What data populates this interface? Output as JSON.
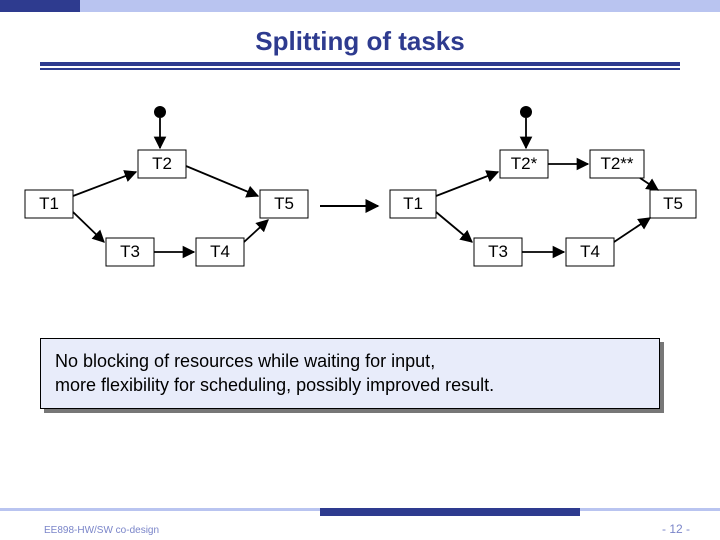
{
  "title": "Splitting of tasks",
  "caption_line1": "No blocking of resources while waiting for input,",
  "caption_line2": "more flexibility for scheduling, possibly improved result.",
  "footer": {
    "course": "EE898-HW/SW co-design",
    "page": "- 12 -"
  },
  "graph_left": {
    "nodes": [
      "T1",
      "T2",
      "T3",
      "T4",
      "T5",
      "●"
    ],
    "edges": [
      [
        "●",
        "T2"
      ],
      [
        "T1",
        "T2"
      ],
      [
        "T1",
        "T3"
      ],
      [
        "T3",
        "T4"
      ],
      [
        "T2",
        "T5"
      ],
      [
        "T4",
        "T5"
      ]
    ]
  },
  "graph_right": {
    "nodes": [
      "T1",
      "T2*",
      "T2**",
      "T3",
      "T4",
      "T5",
      "●"
    ],
    "edges": [
      [
        "●",
        "T2*"
      ],
      [
        "T1",
        "T2*"
      ],
      [
        "T2*",
        "T2**"
      ],
      [
        "T1",
        "T3"
      ],
      [
        "T3",
        "T4"
      ],
      [
        "T2**",
        "T5"
      ],
      [
        "T4",
        "T5"
      ]
    ]
  }
}
